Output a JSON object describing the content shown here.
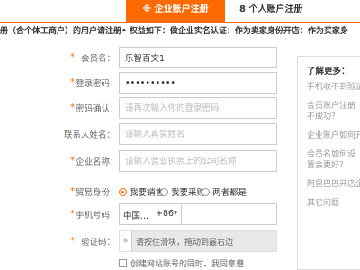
{
  "tabs": [
    {
      "label": "※ 企业账户注册"
    },
    {
      "label": "8 个人账户注册"
    }
  ],
  "notice": "册（含个体工商户）的用户请注册• 权益如下：做企业实名认证：作为卖家身份开店：作为买家身",
  "form": {
    "member_name": {
      "label": "会员名：",
      "value": "乐智百文1"
    },
    "password": {
      "label": "登录密码：",
      "value": "••••••••••"
    },
    "confirm_password": {
      "label": "密码确认：",
      "placeholder": "请再次输入你的登录密码"
    },
    "contact_name": {
      "label": "联系人姓名：",
      "placeholder": "请输入真实姓名"
    },
    "company_name": {
      "label": "企业名称：",
      "placeholder": "请输入营业执照上的公司名称"
    },
    "trade_identity": {
      "label": "贸易身份：",
      "options": [
        "我要销售",
        "我要采购",
        "两者都是"
      ],
      "selected_index": 0
    },
    "phone": {
      "label": "手机号码：",
      "country": "中国...",
      "code": "+86",
      "caret": "▾"
    },
    "captcha": {
      "label": "验证码：",
      "handle": "»",
      "hint": "请按住滑块，拖动到最右边"
    },
    "agree": {
      "text": "创建网站账号的同时，我同意遵"
    }
  },
  "sidebar": {
    "title": "了解更多：",
    "items": [
      "手机收不到验证码",
      "会员账户注册不成功？",
      "企业账户如何开店",
      "会员名如何设置会更好？",
      "阿里巴巴开店企业认证",
      "其它问题"
    ]
  },
  "colors": {
    "accent": "#ff6a00"
  }
}
